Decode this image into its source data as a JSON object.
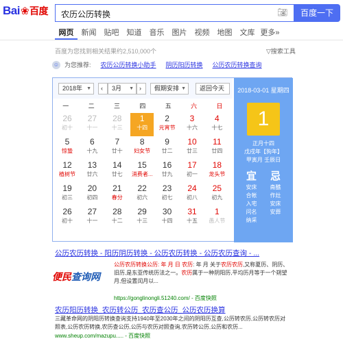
{
  "logo": {
    "brand": "Bai",
    "paw": "❀",
    "cn": "百度"
  },
  "search": {
    "query": "农历公历转换",
    "button": "百度一下"
  },
  "tabs": [
    "网页",
    "新闻",
    "贴吧",
    "知道",
    "音乐",
    "图片",
    "视频",
    "地图",
    "文库",
    "更多»"
  ],
  "result_count": "百度为您找到相关结果约2,510,000个",
  "tools": "搜索工具",
  "recommend": {
    "label": "为您推荐:",
    "links": [
      "农历公历转换小助手",
      "阴历阳历转换",
      "公历农历转换查询"
    ]
  },
  "calendar": {
    "year": "2018年",
    "month": "3月",
    "holiday": "假期安排",
    "today_btn": "返回今天",
    "weekdays": [
      "一",
      "二",
      "三",
      "四",
      "五",
      "六",
      "日"
    ],
    "days": [
      {
        "d": "26",
        "l": "初十",
        "o": 1
      },
      {
        "d": "27",
        "l": "十一",
        "o": 1
      },
      {
        "d": "28",
        "l": "十三",
        "o": 1
      },
      {
        "d": "1",
        "l": "十四",
        "t": 1
      },
      {
        "d": "2",
        "l": "元宵节",
        "r": 1
      },
      {
        "d": "3",
        "l": "十六"
      },
      {
        "d": "4",
        "l": "十七"
      },
      {
        "d": "5",
        "l": "惊蛰",
        "r": 1
      },
      {
        "d": "6",
        "l": "十九"
      },
      {
        "d": "7",
        "l": "廿十"
      },
      {
        "d": "8",
        "l": "妇女节",
        "r": 1
      },
      {
        "d": "9",
        "l": "廿二"
      },
      {
        "d": "10",
        "l": "廿三"
      },
      {
        "d": "11",
        "l": "廿四"
      },
      {
        "d": "12",
        "l": "植树节",
        "r": 1
      },
      {
        "d": "13",
        "l": "廿六"
      },
      {
        "d": "14",
        "l": "廿七"
      },
      {
        "d": "15",
        "l": "消费者...",
        "r": 1
      },
      {
        "d": "16",
        "l": "廿九"
      },
      {
        "d": "17",
        "l": "初一"
      },
      {
        "d": "18",
        "l": "龙头节",
        "r": 1
      },
      {
        "d": "19",
        "l": "初三"
      },
      {
        "d": "20",
        "l": "初四"
      },
      {
        "d": "21",
        "l": "春分",
        "r": 1
      },
      {
        "d": "22",
        "l": "初六"
      },
      {
        "d": "23",
        "l": "初七"
      },
      {
        "d": "24",
        "l": "初八"
      },
      {
        "d": "25",
        "l": "初九"
      },
      {
        "d": "26",
        "l": "初十"
      },
      {
        "d": "27",
        "l": "十一"
      },
      {
        "d": "28",
        "l": "十二"
      },
      {
        "d": "29",
        "l": "十三"
      },
      {
        "d": "30",
        "l": "十四"
      },
      {
        "d": "31",
        "l": "十五"
      },
      {
        "d": "1",
        "l": "愚人节",
        "o": 1
      }
    ],
    "side": {
      "date": "2018-03-01 星期四",
      "big": "1",
      "lunar": "正月十四",
      "ganzhi_year": "戊戌年【狗年】",
      "ganzhi_day": "甲寅月 壬辰日",
      "yi_title": "宜",
      "yi": [
        "安床",
        "合帐",
        "入宅",
        "问名",
        "纳采"
      ],
      "ji_title": "忌",
      "ji": [
        "斋醮",
        "作灶",
        "安床",
        "安葬"
      ]
    }
  },
  "result1": {
    "title": "公历农历转换 - 阳历阴历转换 - 公历农历转换 - 公历农历查询 - ...",
    "logo_a": "便民",
    "logo_b": "查询网",
    "desc_a": "公历农历转换公历: 年 月 日",
    "desc_hl1": "农历",
    "desc_b": ": 年 月 关于",
    "desc_hl2": "农历农历",
    "desc_c": "又称夏历、阴历、旧历,是东亚传统历法之一。",
    "desc_hl3": "农历",
    "desc_d": "属于一种阴阳历,平均历月等于一个朔望月,但设置闰月以...",
    "url": "https://gonglinongli.51240.com/ - 百度快照"
  },
  "result2": {
    "title": "农历阳历转换_农历转公历_农历查公历_公历农历换算",
    "desc": "三藏革命网的阴阳历转换查询支持1940年至2030年之间的阴阳历互查,公历转农历,公历转农历对照表,公历农历转换,农历查公历,公历与农历对照查询,农历转公历,公历和农历...",
    "url": "www.sheup.com/mazupu..... - 百度快照"
  }
}
